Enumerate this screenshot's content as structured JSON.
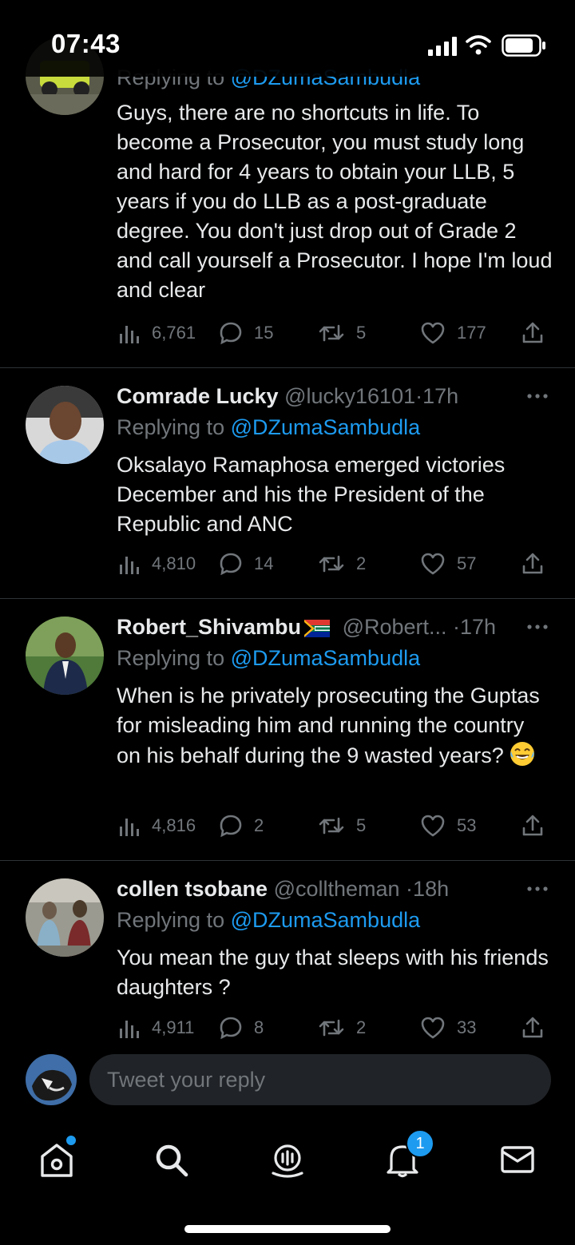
{
  "status_bar": {
    "time": "07:43"
  },
  "tweets": [
    {
      "author": "",
      "handle": "",
      "time": "",
      "replying_to_label": "Replying to",
      "replying_to": "@DZumaSambudla",
      "text": "Guys, there are no shortcuts in life. To become a Prosecutor, you must study long and hard for 4 years to obtain your LLB, 5 years if you do LLB as a post-graduate degree. You don't just drop out of Grade 2 and call yourself a Prosecutor. I hope I'm loud and clear",
      "views": "6,761",
      "replies": "15",
      "retweets": "5",
      "likes": "177"
    },
    {
      "author": "Comrade Lucky",
      "handle": "@lucky16101",
      "time": "17h",
      "replying_to_label": "Replying to",
      "replying_to": "@DZumaSambudla",
      "text": "Oksalayo Ramaphosa emerged victories December and his the President of the Republic and ANC",
      "views": "4,810",
      "replies": "14",
      "retweets": "2",
      "likes": "57"
    },
    {
      "author": "Robert_Shivambu",
      "handle": "@Robert...",
      "time": "17h",
      "replying_to_label": "Replying to",
      "replying_to": "@DZumaSambudla",
      "text": "When is he privately prosecuting the Guptas for misleading him and running the country on his behalf during the 9 wasted years?",
      "views": "4,816",
      "replies": "2",
      "retweets": "5",
      "likes": "53"
    },
    {
      "author": "collen tsobane",
      "handle": "@colltheman",
      "time": "18h",
      "replying_to_label": "Replying to",
      "replying_to": "@DZumaSambudla",
      "text": "You mean the guy that sleeps with his friends daughters ?",
      "views": "4,911",
      "replies": "8",
      "retweets": "2",
      "likes": "33"
    }
  ],
  "composer": {
    "placeholder": "Tweet your reply"
  },
  "nav": {
    "notifications_badge": "1"
  },
  "colors": {
    "accent": "#1d9bf0",
    "muted": "#71767b",
    "text": "#e7e9ea",
    "divider": "#2f3336"
  }
}
